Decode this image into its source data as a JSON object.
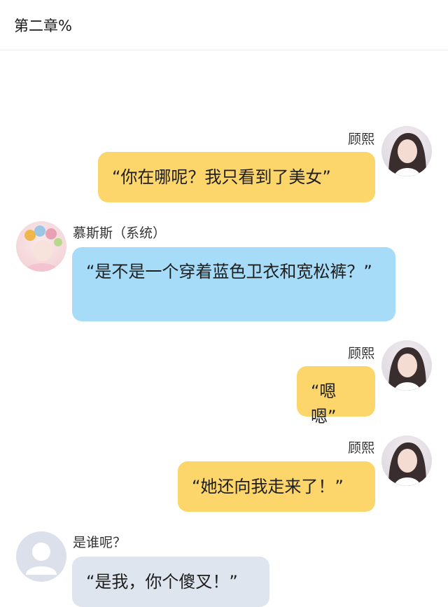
{
  "header": {
    "title": "第二章%"
  },
  "messages": [
    {
      "side": "right",
      "name": "顾熙",
      "text": "“你在哪呢？我只看到了美女”",
      "avatar": "girl-avatar",
      "color": "#fcd66a"
    },
    {
      "side": "left",
      "name": "慕斯斯（系统）",
      "text": "“是不是一个穿着蓝色卫衣和宽松裤？”",
      "avatar": "kid-avatar",
      "color": "#a6dcf7"
    },
    {
      "side": "right",
      "name": "顾熙",
      "text": "“嗯嗯”",
      "avatar": "girl-avatar",
      "color": "#fcd66a"
    },
    {
      "side": "right",
      "name": "顾熙",
      "text": "“她还向我走来了！”",
      "avatar": "girl-avatar",
      "color": "#fcd66a"
    },
    {
      "side": "left",
      "name": "是谁呢？",
      "text": "“是我，你个傻叉！”",
      "avatar": "default-user-avatar",
      "color": "#dfe5ee"
    }
  ]
}
